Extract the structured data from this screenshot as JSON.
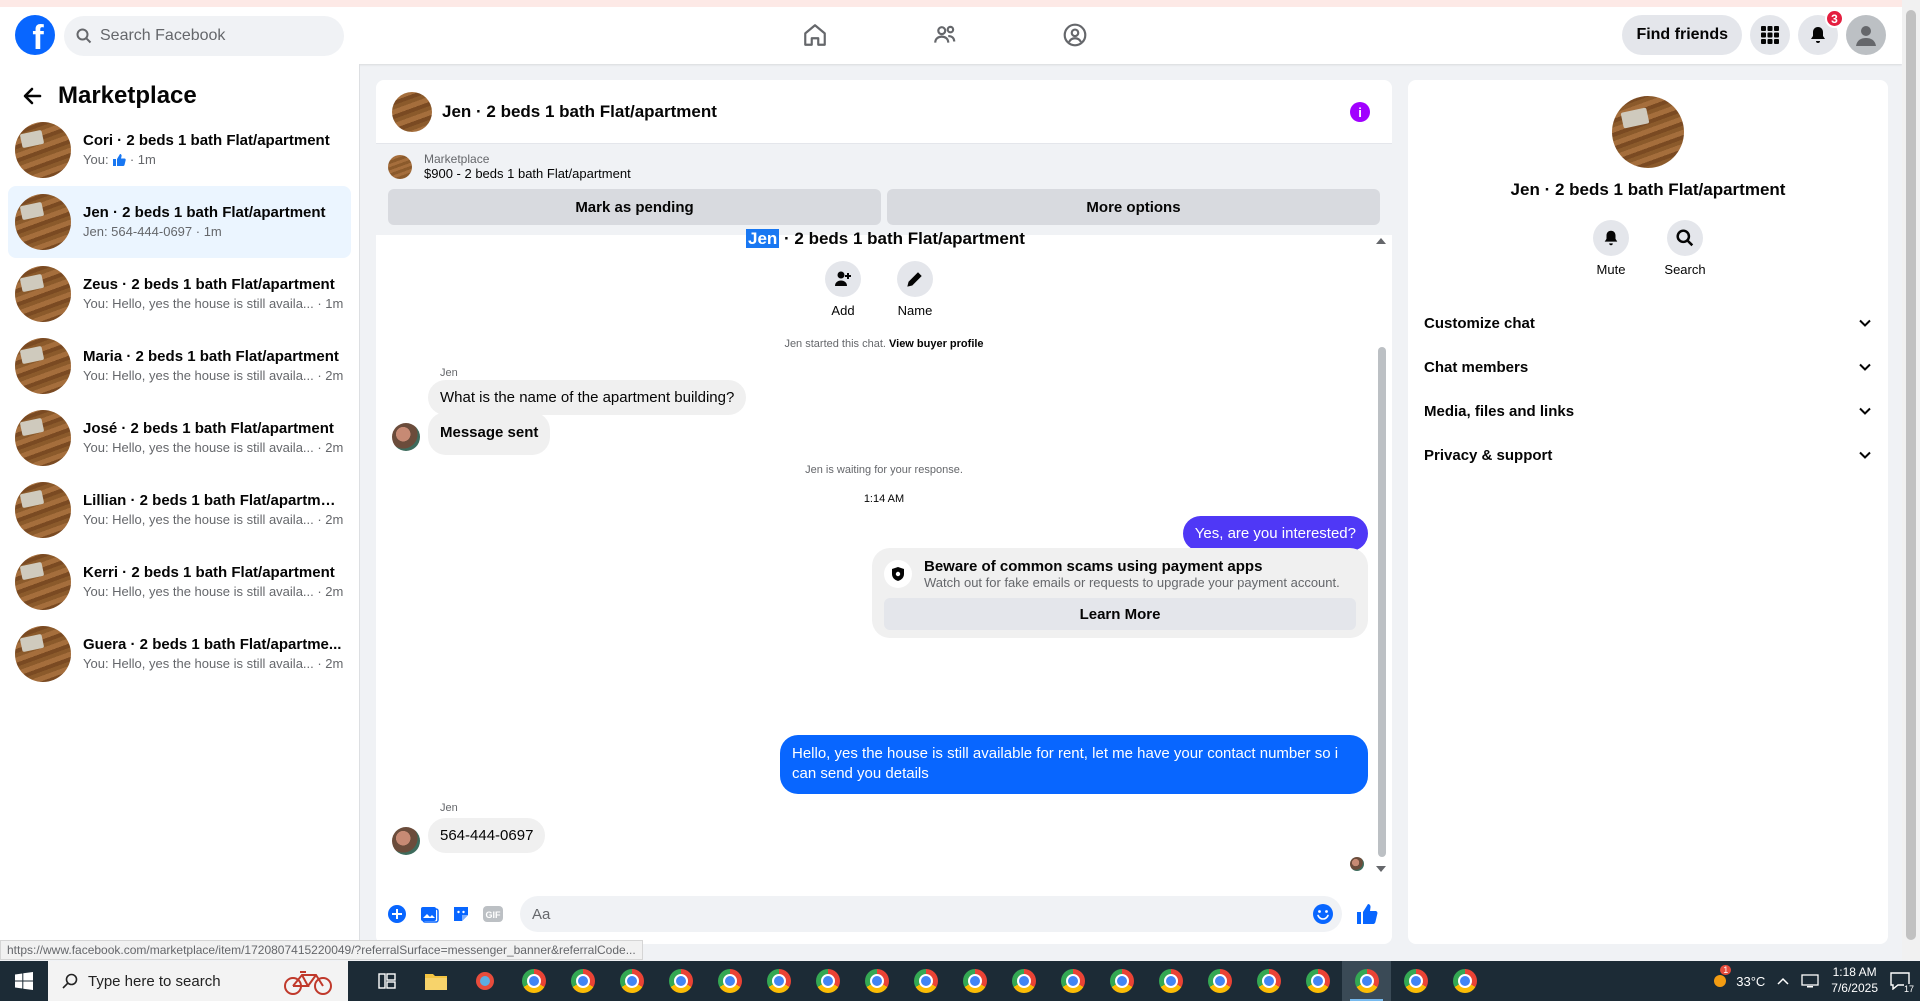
{
  "topnav": {
    "logo_letter": "f",
    "search_placeholder": "Search Facebook",
    "find_friends_label": "Find friends",
    "notifications_count": "3",
    "brand_color": "#0866ff"
  },
  "sidebar": {
    "title": "Marketplace",
    "conversations": [
      {
        "title": "Cori · 2 beds 1 bath Flat/apartment",
        "subtitle_prefix": "You:",
        "subtitle": "· 1m",
        "has_like": true
      },
      {
        "title": "Jen · 2 beds 1 bath Flat/apartment",
        "subtitle": "Jen: 564-444-0697 · 1m"
      },
      {
        "title": "Zeus · 2 beds 1 bath Flat/apartment",
        "subtitle": "You: Hello, yes the house is still availa... · 1m"
      },
      {
        "title": "Maria · 2 beds 1 bath Flat/apartment",
        "subtitle": "You: Hello, yes the house is still availa... · 2m"
      },
      {
        "title": "José · 2 beds 1 bath Flat/apartment",
        "subtitle": "You: Hello, yes the house is still availa... · 2m"
      },
      {
        "title": "Lillian · 2 beds 1 bath Flat/apartment",
        "subtitle": "You: Hello, yes the house is still availa... · 2m"
      },
      {
        "title": "Kerri · 2 beds 1 bath Flat/apartment",
        "subtitle": "You: Hello, yes the house is still availa... · 2m"
      },
      {
        "title": "Guera · 2 beds 1 bath Flat/apartme...",
        "subtitle": "You: Hello, yes the house is still availa... · 2m"
      }
    ]
  },
  "chat": {
    "title": "Jen · 2 beds 1 bath Flat/apartment",
    "listing_source": "Marketplace",
    "listing_desc": "$900 - 2 beds 1 bath Flat/apartment",
    "mark_pending_label": "Mark as pending",
    "more_options_label": "More options",
    "partial_title_hl": "Jen",
    "partial_title_rest": " · 2 beds 1 bath Flat/apartment",
    "add_label": "Add",
    "name_label": "Name",
    "started_note": "Jen started this chat.",
    "view_profile_link": "View buyer profile",
    "sender_name": "Jen",
    "msg_question": "What is the name of the apartment building?",
    "msg_sent": "Message sent",
    "waiting_note": "Jen is waiting for your response.",
    "timestamp": "1:14 AM",
    "msg_interested": "Yes, are you interested?",
    "scam_title": "Beware of common scams using payment apps",
    "scam_sub": "Watch out for fake emails or requests to upgrade your payment account.",
    "learn_more_label": "Learn More",
    "msg_reply_line1": "Hello, yes the house is still available for rent, let me have your contact number so i",
    "msg_reply_line2": "can send you details",
    "msg_phone": "564-444-0697",
    "composer_placeholder": "Aa",
    "composer_gif_label": "GIF"
  },
  "details": {
    "title": "Jen · 2 beds 1 bath Flat/apartment",
    "mute_label": "Mute",
    "search_label": "Search",
    "sections": [
      "Customize chat",
      "Chat members",
      "Media, files and links",
      "Privacy & support"
    ]
  },
  "status_url": "https://www.facebook.com/marketplace/item/1720807415220049/?referralSurface=messenger_banner&referralCode...",
  "taskbar": {
    "search_placeholder": "Type here to search",
    "weather": "33°C",
    "time": "1:18 AM",
    "date": "7/6/2025",
    "notification_count": "17",
    "weather_badge": "1"
  }
}
